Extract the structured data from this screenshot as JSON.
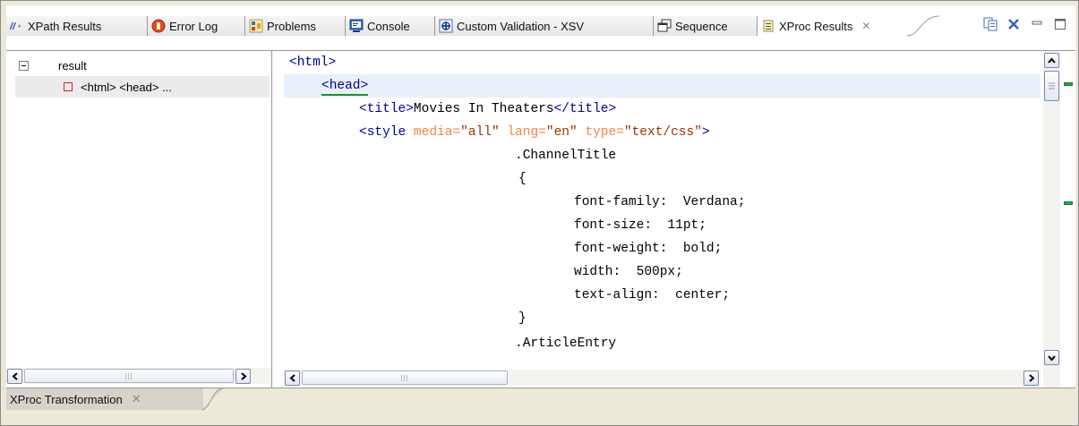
{
  "tabs": [
    {
      "label": "XPath Results",
      "icon": "xpath-icon"
    },
    {
      "label": "Error Log",
      "icon": "error-log-icon"
    },
    {
      "label": "Problems",
      "icon": "problems-icon"
    },
    {
      "label": "Console",
      "icon": "console-icon"
    },
    {
      "label": "Custom Validation - XSV",
      "icon": "validation-icon"
    },
    {
      "label": "Sequence",
      "icon": "sequence-icon"
    },
    {
      "label": "XProc Results",
      "icon": "xproc-results-icon"
    }
  ],
  "active_tab_close": "✕",
  "tree": {
    "root_label": "result",
    "child_label": "<html>  <head> ..."
  },
  "code": [
    [
      {
        "t": "tag",
        "v": "<html>"
      }
    ],
    [
      {
        "t": "tag",
        "v": "<head>"
      }
    ],
    [
      {
        "t": "tag",
        "v": "<title>"
      },
      {
        "t": "txt",
        "v": "Movies In Theaters"
      },
      {
        "t": "tag",
        "v": "</title>"
      }
    ],
    [
      {
        "t": "tag",
        "v": "<style "
      },
      {
        "t": "attr",
        "v": "media="
      },
      {
        "t": "val",
        "v": "\"all\" "
      },
      {
        "t": "attr",
        "v": "lang="
      },
      {
        "t": "val",
        "v": "\"en\" "
      },
      {
        "t": "attr",
        "v": "type="
      },
      {
        "t": "val",
        "v": "\"text/css\""
      },
      {
        "t": "tag",
        "v": ">"
      }
    ],
    [
      {
        "t": "txt",
        "v": ".ChannelTitle"
      }
    ],
    [
      {
        "t": "txt",
        "v": "{"
      }
    ],
    [
      {
        "t": "txt",
        "v": "font-family:  Verdana;"
      }
    ],
    [
      {
        "t": "txt",
        "v": "font-size:  11pt;"
      }
    ],
    [
      {
        "t": "txt",
        "v": "font-weight:  bold;"
      }
    ],
    [
      {
        "t": "txt",
        "v": "width:  500px;"
      }
    ],
    [
      {
        "t": "txt",
        "v": "text-align:  center;"
      }
    ],
    [
      {
        "t": "txt",
        "v": "}"
      }
    ],
    [
      {
        "t": "txt",
        "v": ".ArticleEntry"
      }
    ]
  ],
  "bottom_tab": {
    "label": "XProc Transformation"
  },
  "colors": {
    "tag": "#000096",
    "attr": "#f5844c",
    "val": "#993300",
    "highlight": "#e8f1fb"
  }
}
